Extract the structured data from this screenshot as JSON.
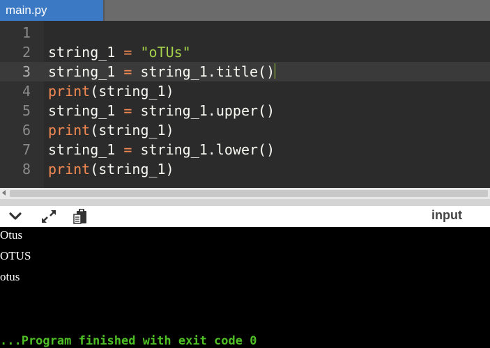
{
  "tab": {
    "filename": "main.py"
  },
  "editor": {
    "active_line": 3,
    "lines": [
      {
        "number": "1",
        "tokens": []
      },
      {
        "number": "2",
        "tokens": [
          {
            "t": "string_1 ",
            "c": "plain"
          },
          {
            "t": "=",
            "c": "op"
          },
          {
            "t": " ",
            "c": "plain"
          },
          {
            "t": "\"oTUs\"",
            "c": "str"
          }
        ]
      },
      {
        "number": "3",
        "tokens": [
          {
            "t": "string_1 ",
            "c": "plain"
          },
          {
            "t": "=",
            "c": "op"
          },
          {
            "t": " string_1.title()",
            "c": "plain"
          }
        ]
      },
      {
        "number": "4",
        "tokens": [
          {
            "t": "print",
            "c": "kw"
          },
          {
            "t": "(string_1)",
            "c": "plain"
          }
        ]
      },
      {
        "number": "5",
        "tokens": [
          {
            "t": "string_1 ",
            "c": "plain"
          },
          {
            "t": "=",
            "c": "op"
          },
          {
            "t": " string_1.upper()",
            "c": "plain"
          }
        ]
      },
      {
        "number": "6",
        "tokens": [
          {
            "t": "print",
            "c": "kw"
          },
          {
            "t": "(string_1)",
            "c": "plain"
          }
        ]
      },
      {
        "number": "7",
        "tokens": [
          {
            "t": "string_1 ",
            "c": "plain"
          },
          {
            "t": "=",
            "c": "op"
          },
          {
            "t": " string_1.lower()",
            "c": "plain"
          }
        ]
      },
      {
        "number": "8",
        "tokens": [
          {
            "t": "print",
            "c": "kw"
          },
          {
            "t": "(string_1)",
            "c": "plain"
          }
        ]
      }
    ]
  },
  "console_toolbar": {
    "collapse_icon": "chevron-down-icon",
    "expand_icon": "expand-arrows-icon",
    "copy_icon": "clipboard-icon",
    "input_label": "input"
  },
  "console": {
    "output": [
      "Otus",
      "OTUS",
      "otus"
    ],
    "finish_message": "...Program finished with exit code 0"
  },
  "colors": {
    "tab_active": "#3c79c4",
    "editor_bg": "#2b2b2b",
    "string": "#a6d14a",
    "keyword": "#f48a52",
    "finish_text": "#4fbf26"
  }
}
